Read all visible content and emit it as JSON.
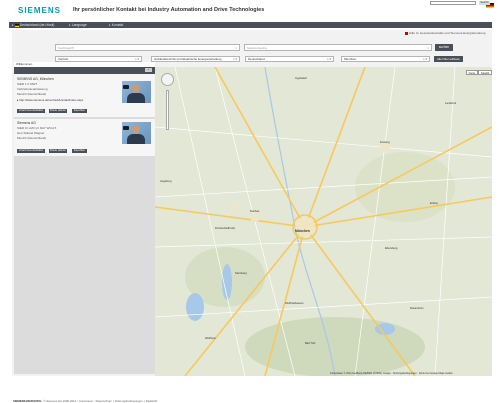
{
  "header": {
    "logo": "SIEMENS",
    "title": "Ihr persönlicher Kontakt bei Industry Automation and Drive Technologies"
  },
  "nav": {
    "items": [
      {
        "label": "Deutschland (de-Hindi)"
      },
      {
        "label": "Language"
      },
      {
        "label": "Kontakt"
      }
    ],
    "search_button": "Search"
  },
  "notice": "Hilfe zu Gesetzeskontakte und Siemens-Energieberatung",
  "search": {
    "location_placeholder": "Suchbegriff",
    "keyword_placeholder": "Standortsuche",
    "search_button": "suchen",
    "reset_button": "Alle Filter auflösen"
  },
  "filters": [
    {
      "value": "Vertrieb"
    },
    {
      "value": "Gebäudetechnik und Elektrische Energieverteilung"
    },
    {
      "value": "Deutschland"
    },
    {
      "value": "München"
    }
  ],
  "results": {
    "header_label": "Willkommen",
    "items": [
      {
        "name": "SIEMENS AG, München",
        "lines": [
          "SIER 1 0 SIWT",
          "Vertriebsniederlassung",
          "Munich (Deutschland)"
        ],
        "link": "http://www.siemens.de/vertrieb/kontakt/index.aspx",
        "buttons": [
          "vCard herunterladen",
          "Route planen",
          "Favoriten"
        ]
      },
      {
        "name": "Siemens AG",
        "lines": [
          "SIER IC LMV LV RAY WCH 5",
          "Herr Roland Wagner",
          "Munich (Deutschland)"
        ],
        "link": "",
        "buttons": [
          "vCard herunterladen",
          "Route planen",
          "Favoriten"
        ]
      }
    ]
  },
  "map": {
    "type_buttons": [
      "Karte",
      "Satellit"
    ],
    "city_labels": [
      "München",
      "Freising",
      "Augsburg",
      "Dachau",
      "Erding",
      "Landshut",
      "Ingolstadt",
      "Starnberg",
      "Wolfratshausen",
      "Rosenheim",
      "Fürstenfeldbruck",
      "Ebersberg",
      "Bad Tölz",
      "Weilheim"
    ],
    "attribution": "Kartendaten © 2014 GeoBasis-DE/BKG (©2009), Google · Nutzungsbedingungen · Fehler bei Google Maps melden"
  },
  "footer": {
    "brand": "SIEMENS.DE/DIGITAL",
    "links": [
      "© Siemens AG 1996-2014",
      "Impressum",
      "Datenschutz",
      "Nutzungsbedingungen",
      "Digital ID"
    ]
  },
  "colors": {
    "brand": "#0a9aa9",
    "bar": "#4a5057",
    "panel": "#dcdcdc",
    "map_bg": "#e3e7d6",
    "road_major": "#f7c95c"
  }
}
